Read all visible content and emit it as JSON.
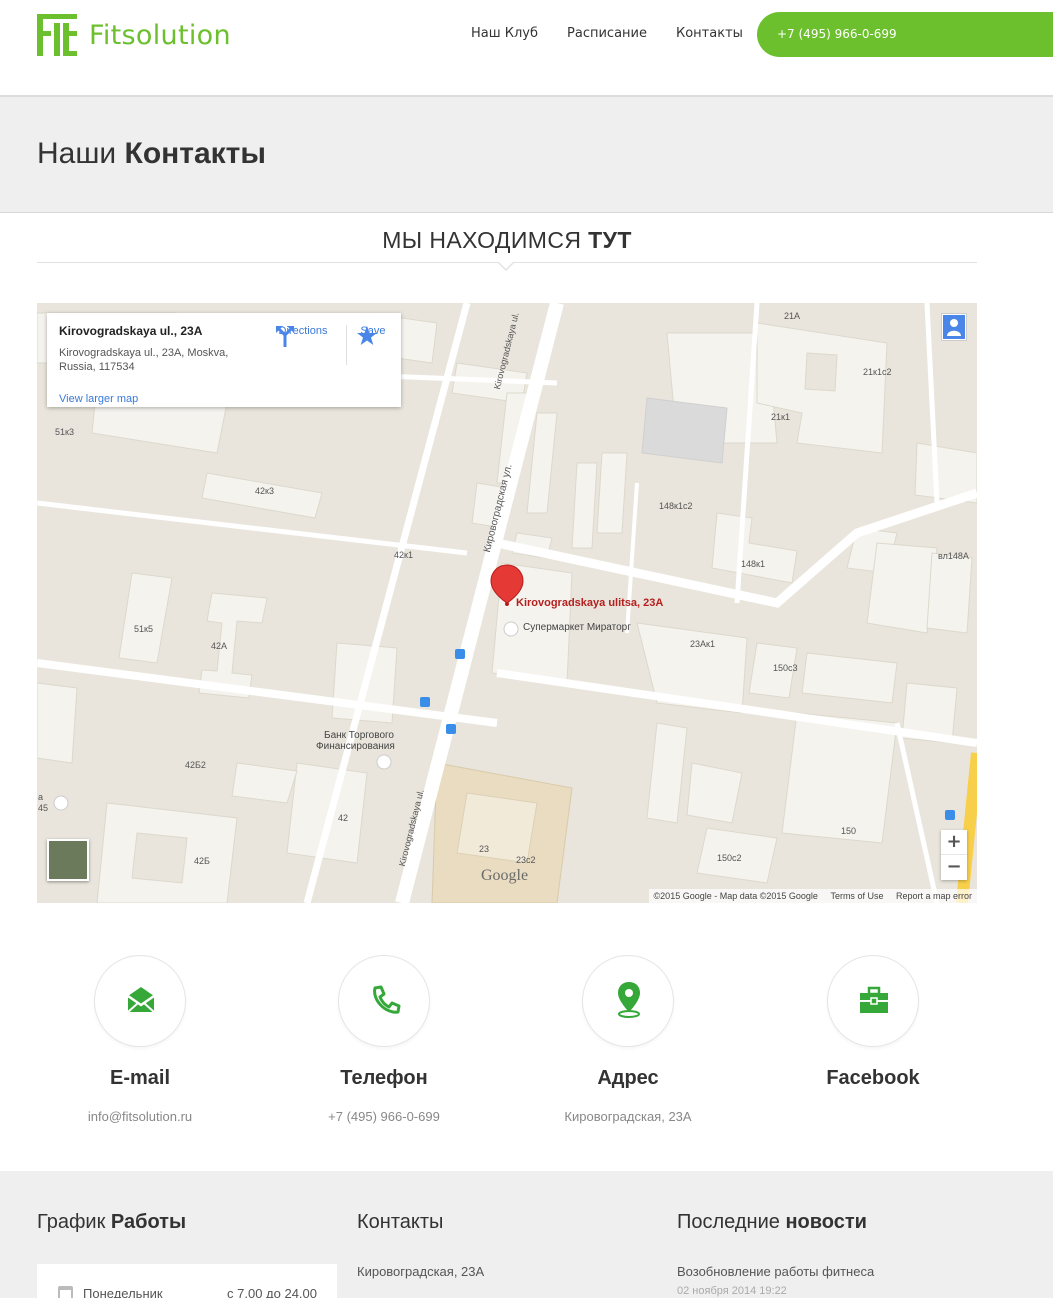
{
  "brand": {
    "name": "Fitsolution",
    "mark": "FIT",
    "color": "#6cc02e"
  },
  "nav": [
    {
      "label": "Наш Клуб"
    },
    {
      "label": "Расписание"
    },
    {
      "label": "Контакты"
    }
  ],
  "header": {
    "phone": "+7 (495) 966-0-699"
  },
  "title": {
    "light": "Наши",
    "bold": "Контакты"
  },
  "section": {
    "light": "МЫ НАХОДИМСЯ",
    "bold": "ТУТ"
  },
  "map": {
    "card_title": "Kirovogradskaya ul., 23A",
    "card_address": "Kirovogradskaya ul., 23A, Moskva, Russia, 117534",
    "larger_map": "View larger map",
    "directions": "Directions",
    "save": "Save",
    "pin_label": "Kirovogradskaya ulitsa, 23A",
    "poi_market": "Супермаркет Мираторг",
    "poi_bank_1": "Банк Торгового",
    "poi_bank_2": "Финансирования",
    "street_vert_1": "Kirovogradskaya ul.",
    "street_ru": "Кировоградская ул.",
    "street_vert_2": "Kirovogradskaya ul.",
    "zoom_in": "+",
    "zoom_out": "−",
    "google": "Google",
    "attrib": "©2015 Google - Map data ©2015 Google",
    "terms": "Terms of Use",
    "report": "Report a map error",
    "labels": [
      "51к3",
      "42к3",
      "42к1",
      "51к5",
      "42А",
      "42Б2",
      "42",
      "42Б",
      "23",
      "23с2",
      "21А",
      "21к1с2",
      "21к1",
      "148к1с2",
      "148к1",
      "вл148А",
      "23Ак1",
      "150с3",
      "150",
      "150с2",
      "45",
      "а"
    ]
  },
  "contacts": [
    {
      "name": "E-mail",
      "value": "info@fitsolution.ru",
      "icon": "envelope-icon"
    },
    {
      "name": "Телефон",
      "value": "+7 (495) 966-0-699",
      "icon": "phone-icon"
    },
    {
      "name": "Адрес",
      "value": "Кировоградская, 23А",
      "icon": "map-pin-icon"
    },
    {
      "name": "Facebook",
      "value": "",
      "icon": "briefcase-icon"
    }
  ],
  "footer": {
    "schedule": {
      "light": "График",
      "bold": "Работы",
      "day": "Понедельник",
      "time": "с 7.00 до 24.00"
    },
    "contacts": {
      "light": "Контакты",
      "address": "Кировоградская, 23А"
    },
    "news": {
      "light": "Последние",
      "bold": "новости",
      "item": "Возобновление работы фитнеса",
      "date": "02 ноября 2014 19:22"
    }
  }
}
